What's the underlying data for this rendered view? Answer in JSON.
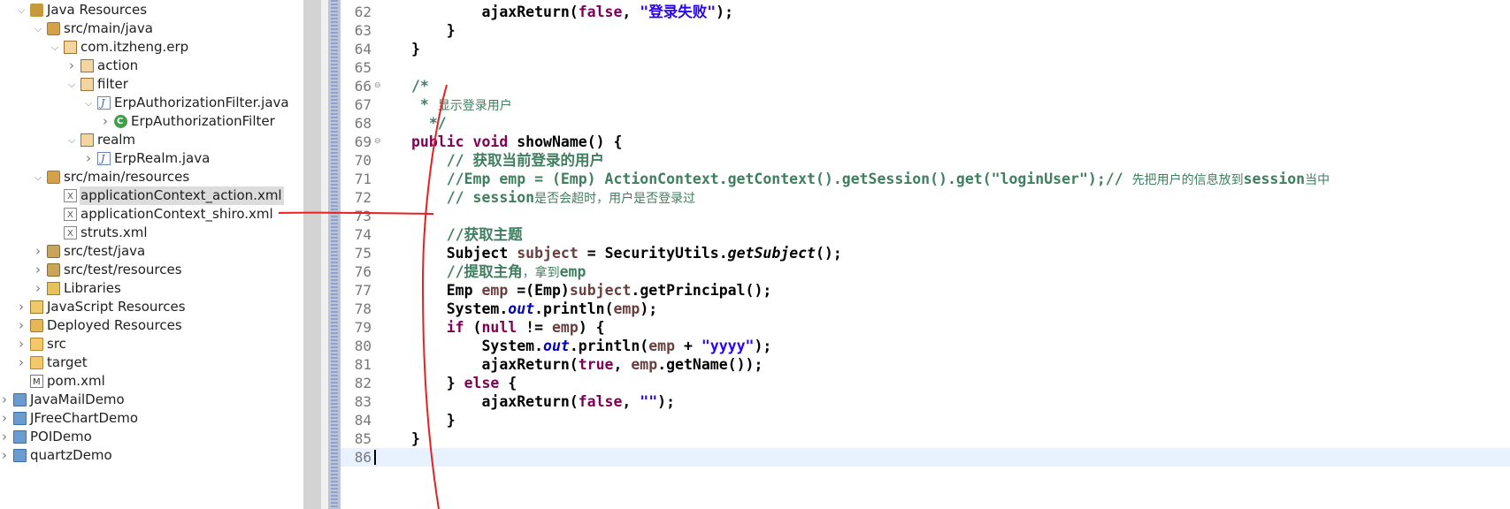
{
  "explorer": {
    "items": [
      {
        "label": "Java Resources",
        "depth": 0,
        "twisty": "open",
        "icon": "java-resources-icon"
      },
      {
        "label": "src/main/java",
        "depth": 1,
        "twisty": "open",
        "icon": "source-folder-icon"
      },
      {
        "label": "com.itzheng.erp",
        "depth": 2,
        "twisty": "open",
        "icon": "package-icon"
      },
      {
        "label": "action",
        "depth": 3,
        "twisty": "closed",
        "icon": "package-icon"
      },
      {
        "label": "filter",
        "depth": 3,
        "twisty": "open",
        "icon": "package-icon"
      },
      {
        "label": "ErpAuthorizationFilter.java",
        "depth": 4,
        "twisty": "open",
        "icon": "java-file-icon"
      },
      {
        "label": "ErpAuthorizationFilter",
        "depth": 5,
        "twisty": "closed",
        "icon": "class-icon"
      },
      {
        "label": "realm",
        "depth": 3,
        "twisty": "open",
        "icon": "package-icon"
      },
      {
        "label": "ErpRealm.java",
        "depth": 4,
        "twisty": "closed",
        "icon": "java-file-icon"
      },
      {
        "label": "src/main/resources",
        "depth": 1,
        "twisty": "open",
        "icon": "source-folder-icon"
      },
      {
        "label": "applicationContext_action.xml",
        "depth": 2,
        "twisty": "none",
        "icon": "xml-file-icon",
        "selected": true
      },
      {
        "label": "applicationContext_shiro.xml",
        "depth": 2,
        "twisty": "none",
        "icon": "xml-file-icon"
      },
      {
        "label": "struts.xml",
        "depth": 2,
        "twisty": "none",
        "icon": "xml-file-icon"
      },
      {
        "label": "src/test/java",
        "depth": 1,
        "twisty": "closed",
        "icon": "test-folder-icon"
      },
      {
        "label": "src/test/resources",
        "depth": 1,
        "twisty": "closed",
        "icon": "test-folder-icon"
      },
      {
        "label": "Libraries",
        "depth": 1,
        "twisty": "closed",
        "icon": "library-icon"
      },
      {
        "label": "JavaScript Resources",
        "depth": 0,
        "twisty": "closed",
        "icon": "javascript-resources-icon"
      },
      {
        "label": "Deployed Resources",
        "depth": 0,
        "twisty": "closed",
        "icon": "deployed-resources-icon"
      },
      {
        "label": "src",
        "depth": 0,
        "twisty": "closed",
        "icon": "folder-icon"
      },
      {
        "label": "target",
        "depth": 0,
        "twisty": "closed",
        "icon": "folder-icon"
      },
      {
        "label": "pom.xml",
        "depth": 0,
        "twisty": "none",
        "icon": "pom-file-icon"
      },
      {
        "label": "JavaMailDemo",
        "depth": -1,
        "twisty": "closed",
        "icon": "project-icon"
      },
      {
        "label": "JFreeChartDemo",
        "depth": -1,
        "twisty": "closed",
        "icon": "project-icon"
      },
      {
        "label": "POIDemo",
        "depth": -1,
        "twisty": "closed",
        "icon": "project-icon"
      },
      {
        "label": "quartzDemo",
        "depth": -1,
        "twisty": "closed",
        "icon": "project-icon"
      }
    ]
  },
  "editor": {
    "current_line": "86",
    "lines": [
      {
        "n": "62",
        "fold": "",
        "tokens": [
          [
            "p",
            "        ajaxReturn("
          ],
          [
            "kw",
            "false"
          ],
          [
            "p",
            ", "
          ],
          [
            "str",
            "\"登录失败\""
          ],
          [
            "p",
            ");"
          ]
        ]
      },
      {
        "n": "63",
        "fold": "",
        "tokens": [
          [
            "p",
            "    }"
          ]
        ]
      },
      {
        "n": "64",
        "fold": "",
        "tokens": [
          [
            "p",
            "}"
          ]
        ]
      },
      {
        "n": "65",
        "fold": "",
        "tokens": [
          [
            "p",
            ""
          ]
        ]
      },
      {
        "n": "66",
        "fold": "⊖",
        "tokens": [
          [
            "cm",
            "/*"
          ]
        ]
      },
      {
        "n": "67",
        "fold": "",
        "tokens": [
          [
            "cm",
            " * "
          ],
          [
            "cmcjk",
            "显示登录用户"
          ]
        ]
      },
      {
        "n": "68",
        "fold": "",
        "tokens": [
          [
            "cm",
            "  */"
          ]
        ]
      },
      {
        "n": "69",
        "fold": "⊖",
        "tokens": [
          [
            "kw",
            "public"
          ],
          [
            "p",
            " "
          ],
          [
            "kw",
            "void"
          ],
          [
            "p",
            " showName() {"
          ]
        ]
      },
      {
        "n": "70",
        "fold": "",
        "tokens": [
          [
            "cm",
            "    // 获取当前登录的用户"
          ]
        ]
      },
      {
        "n": "71",
        "fold": "",
        "tokens": [
          [
            "cm",
            "    //Emp emp = (Emp) ActionContext.getContext().getSession().get(\"loginUser\");// "
          ],
          [
            "cmcjk",
            "先把用户的信息放到"
          ],
          [
            "cm",
            "session"
          ],
          [
            "cmcjk",
            "当中"
          ]
        ]
      },
      {
        "n": "72",
        "fold": "",
        "tokens": [
          [
            "cm",
            "    // session"
          ],
          [
            "cmcjk",
            "是否会超时，用户是否登录过"
          ]
        ]
      },
      {
        "n": "73",
        "fold": "",
        "tokens": [
          [
            "p",
            ""
          ]
        ]
      },
      {
        "n": "74",
        "fold": "",
        "tokens": [
          [
            "cm",
            "    //获取主题"
          ]
        ]
      },
      {
        "n": "75",
        "fold": "",
        "tokens": [
          [
            "p",
            "    Subject "
          ],
          [
            "var",
            "subject"
          ],
          [
            "p",
            " = SecurityUtils."
          ],
          [
            "it",
            "getSubject"
          ],
          [
            "p",
            "();"
          ]
        ]
      },
      {
        "n": "76",
        "fold": "",
        "tokens": [
          [
            "cm",
            "    //提取主角"
          ],
          [
            "cmcjk",
            "，拿到"
          ],
          [
            "cm",
            "emp"
          ]
        ]
      },
      {
        "n": "77",
        "fold": "",
        "tokens": [
          [
            "p",
            "    Emp "
          ],
          [
            "var",
            "emp"
          ],
          [
            "p",
            " =(Emp)"
          ],
          [
            "var",
            "subject"
          ],
          [
            "p",
            ".getPrincipal();"
          ]
        ]
      },
      {
        "n": "78",
        "fold": "",
        "tokens": [
          [
            "p",
            "    System."
          ],
          [
            "fld",
            "out"
          ],
          [
            "p",
            ".println("
          ],
          [
            "var",
            "emp"
          ],
          [
            "p",
            ");"
          ]
        ]
      },
      {
        "n": "79",
        "fold": "",
        "tokens": [
          [
            "p",
            "    "
          ],
          [
            "kw",
            "if"
          ],
          [
            "p",
            " ("
          ],
          [
            "kw",
            "null"
          ],
          [
            "p",
            " != "
          ],
          [
            "var",
            "emp"
          ],
          [
            "p",
            ") {"
          ]
        ]
      },
      {
        "n": "80",
        "fold": "",
        "tokens": [
          [
            "p",
            "        System."
          ],
          [
            "fld",
            "out"
          ],
          [
            "p",
            ".println("
          ],
          [
            "var",
            "emp"
          ],
          [
            "p",
            " + "
          ],
          [
            "str",
            "\"yyyy\""
          ],
          [
            "p",
            ");"
          ]
        ]
      },
      {
        "n": "81",
        "fold": "",
        "tokens": [
          [
            "p",
            "        ajaxReturn("
          ],
          [
            "kw",
            "true"
          ],
          [
            "p",
            ", "
          ],
          [
            "var",
            "emp"
          ],
          [
            "p",
            ".getName());"
          ]
        ]
      },
      {
        "n": "82",
        "fold": "",
        "tokens": [
          [
            "p",
            "    } "
          ],
          [
            "kw",
            "else"
          ],
          [
            "p",
            " {"
          ]
        ]
      },
      {
        "n": "83",
        "fold": "",
        "tokens": [
          [
            "p",
            "        ajaxReturn("
          ],
          [
            "kw",
            "false"
          ],
          [
            "p",
            ", "
          ],
          [
            "str",
            "\"\""
          ],
          [
            "p",
            ");"
          ]
        ]
      },
      {
        "n": "84",
        "fold": "",
        "tokens": [
          [
            "p",
            "    }"
          ]
        ]
      },
      {
        "n": "85",
        "fold": "",
        "tokens": [
          [
            "p",
            "}"
          ]
        ]
      },
      {
        "n": "86",
        "fold": "",
        "tokens": [
          [
            "p",
            ""
          ]
        ]
      }
    ]
  },
  "annotation": {
    "color": "#e8201f"
  },
  "colors": {
    "keyword": "#7f0055",
    "string": "#2a00ff",
    "comment": "#3f7f5f",
    "field": "#0000c0",
    "local_var": "#6a3e3e"
  }
}
